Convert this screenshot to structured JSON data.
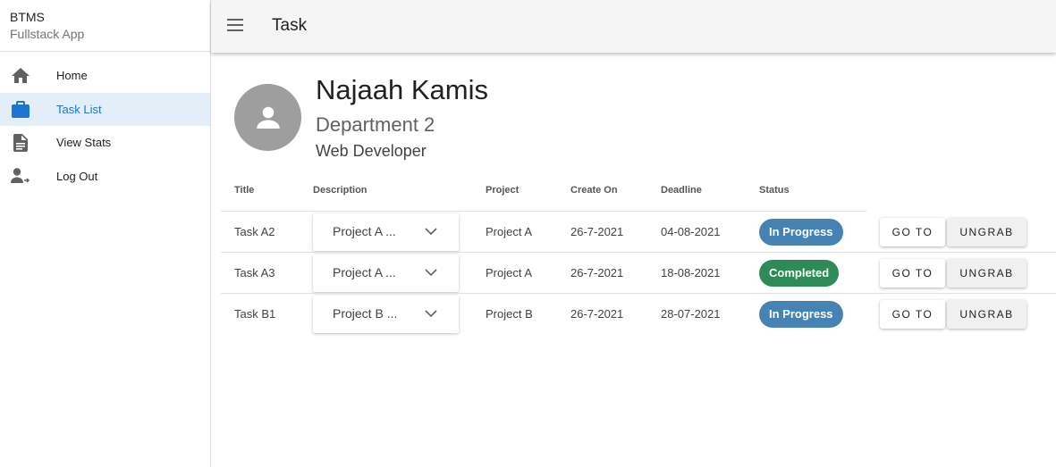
{
  "sidebar": {
    "brand": {
      "title": "BTMS",
      "subtitle": "Fullstack App"
    },
    "items": [
      {
        "label": "Home",
        "icon": "home-icon"
      },
      {
        "label": "Task List",
        "icon": "briefcase-icon",
        "active": true
      },
      {
        "label": "View Stats",
        "icon": "document-icon"
      },
      {
        "label": "Log Out",
        "icon": "logout-icon"
      }
    ]
  },
  "header": {
    "title": "Task",
    "menu_icon": "menu-icon"
  },
  "profile": {
    "name": "Najaah Kamis",
    "department": "Department 2",
    "role": "Web Developer",
    "avatar_icon": "person-icon"
  },
  "table": {
    "columns": [
      "Title",
      "Description",
      "Project",
      "Create On",
      "Deadline",
      "Status"
    ],
    "rows": [
      {
        "title": "Task A2",
        "description": "Project A ...",
        "project": "Project A",
        "created": "26-7-2021",
        "deadline": "04-08-2021",
        "status": "In Progress"
      },
      {
        "title": "Task A3",
        "description": "Project A ...",
        "project": "Project A",
        "created": "26-7-2021",
        "deadline": "18-08-2021",
        "status": "Completed"
      },
      {
        "title": "Task B1",
        "description": "Project B ...",
        "project": "Project B",
        "created": "26-7-2021",
        "deadline": "28-07-2021",
        "status": "In Progress"
      }
    ],
    "actions": {
      "goto": "GO TO",
      "ungrab": "UNGRAB"
    }
  },
  "colors": {
    "accent": "#1976d2",
    "in_progress": "#4682b4",
    "completed": "#2e8b57",
    "header_bg": "#f5f5f5",
    "avatar_bg": "#9e9e9e"
  }
}
